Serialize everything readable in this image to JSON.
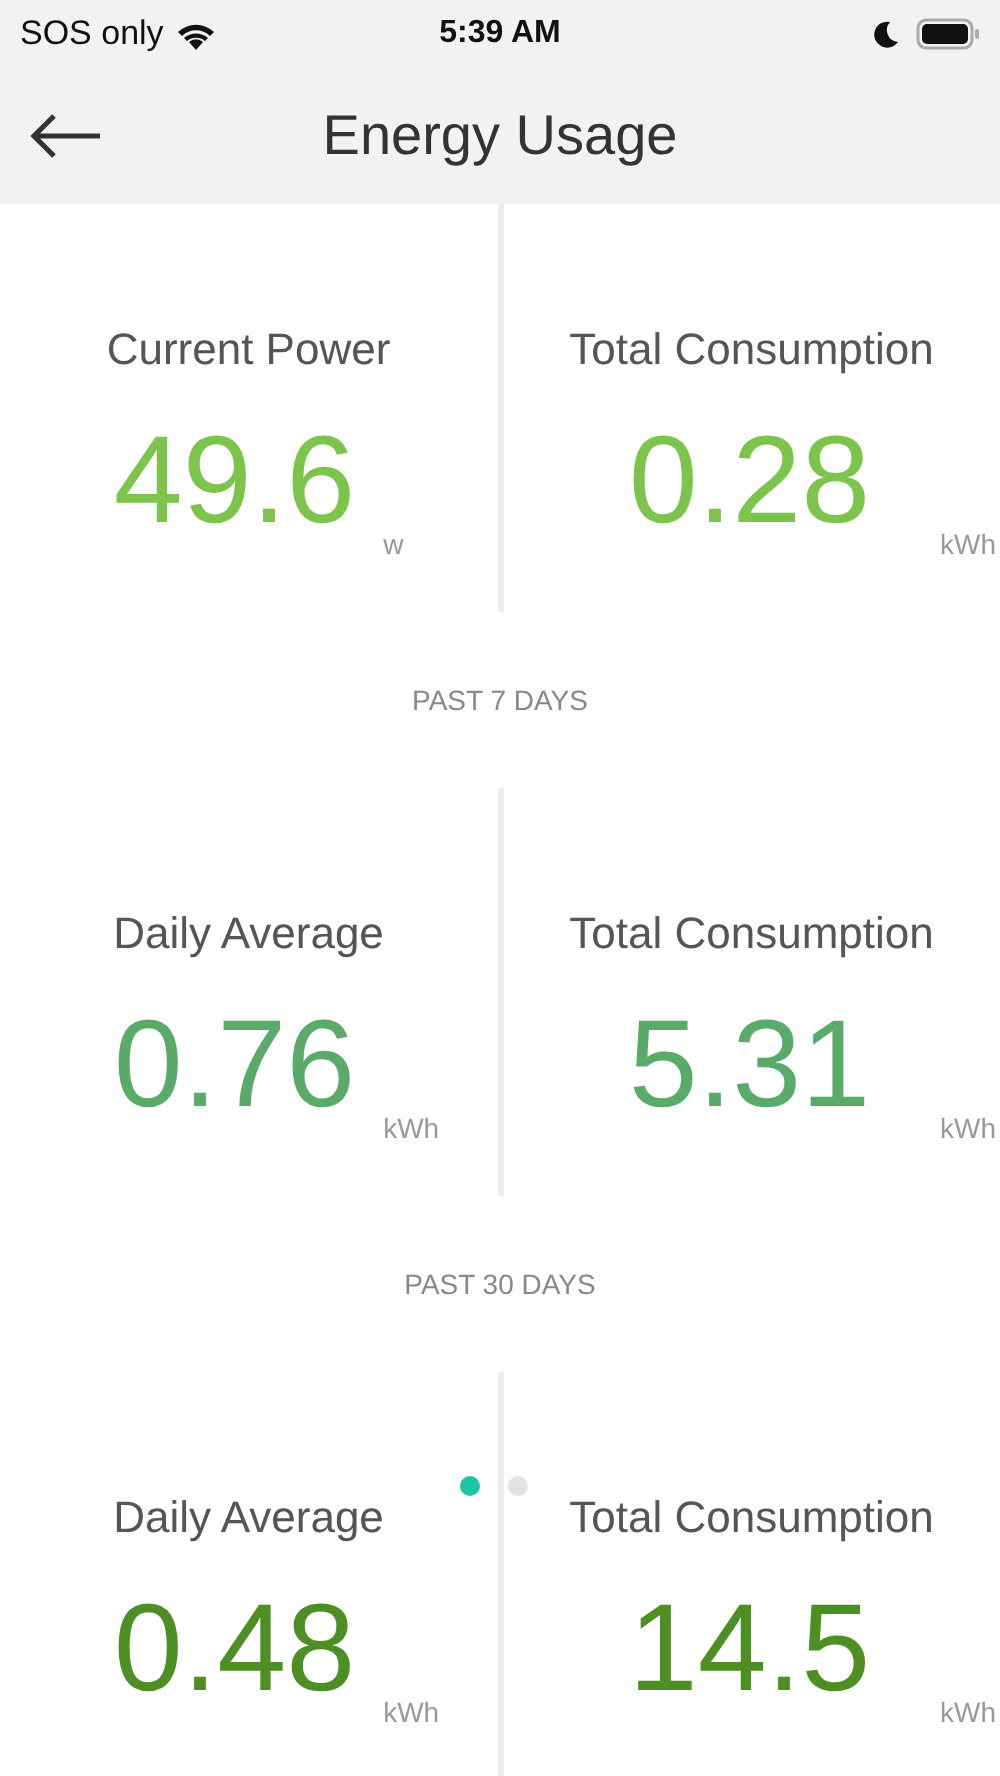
{
  "status_bar": {
    "carrier": "SOS only",
    "time": "5:39 AM"
  },
  "header": {
    "title": "Energy Usage"
  },
  "sections": [
    {
      "color": "#7cc44c",
      "stats": [
        {
          "label": "Current Power",
          "value": "49.6",
          "unit": "w"
        },
        {
          "label": "Total Consumption",
          "value": "0.28",
          "unit": "kWh"
        }
      ]
    },
    {
      "heading": "PAST 7 DAYS",
      "color": "#5aaa6a",
      "stats": [
        {
          "label": "Daily Average",
          "value": "0.76",
          "unit": "kWh"
        },
        {
          "label": "Total Consumption",
          "value": "5.31",
          "unit": "kWh"
        }
      ]
    },
    {
      "heading": "PAST 30 DAYS",
      "color": "#4d8f22",
      "stats": [
        {
          "label": "Daily Average",
          "value": "0.48",
          "unit": "kWh"
        },
        {
          "label": "Total Consumption",
          "value": "14.5",
          "unit": "kWh"
        }
      ]
    }
  ],
  "pager": [
    {
      "selected": true
    },
    {
      "selected": false
    }
  ]
}
